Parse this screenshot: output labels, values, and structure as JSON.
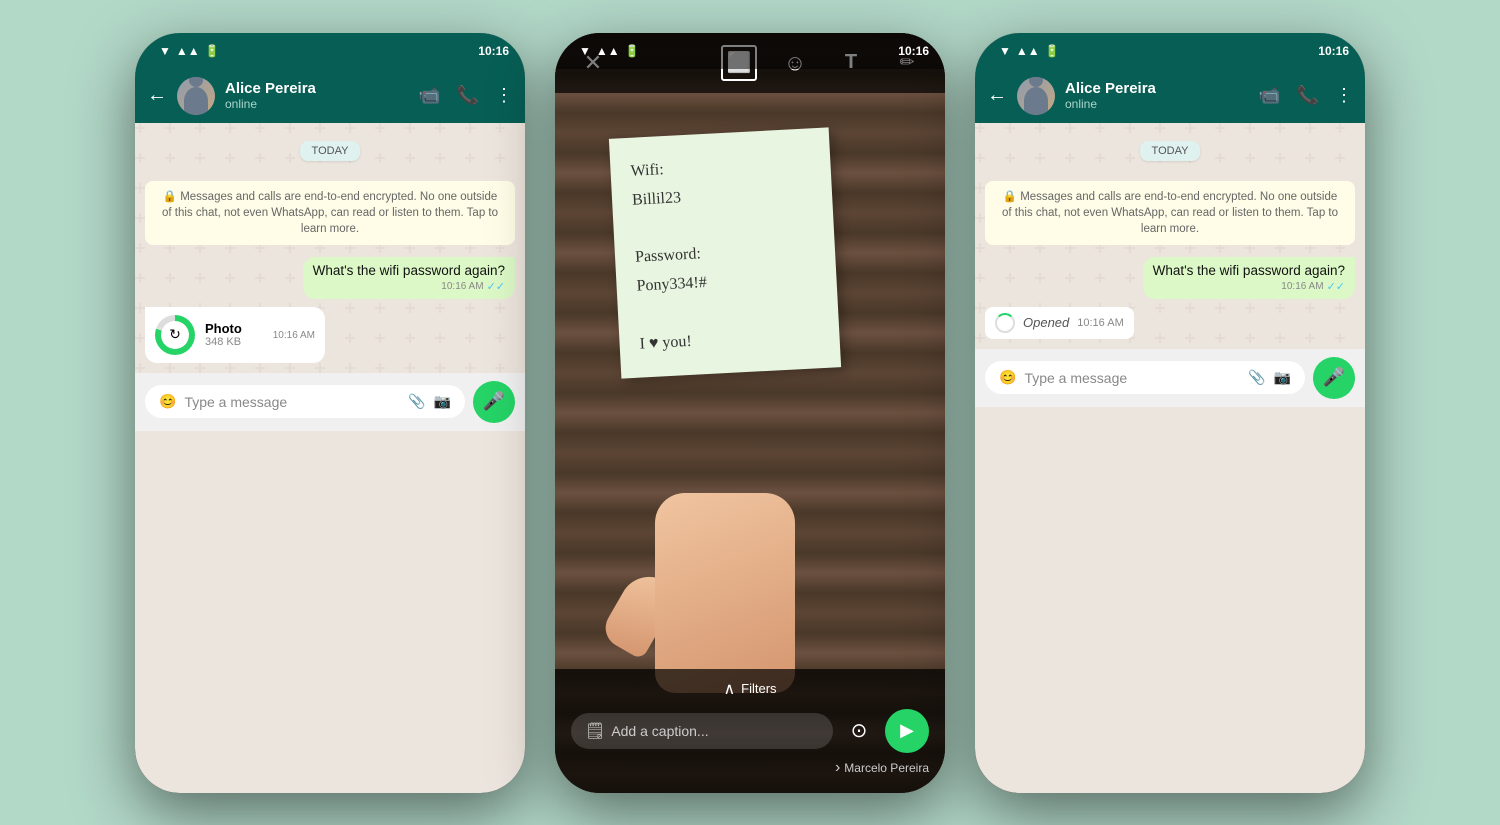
{
  "background": "#b2d8c8",
  "phone1": {
    "status_time": "10:16",
    "header": {
      "contact_name": "Alice Pereira",
      "contact_status": "online",
      "back_label": "←",
      "video_icon": "📹",
      "call_icon": "📞",
      "menu_icon": "⋮"
    },
    "chat": {
      "date_label": "TODAY",
      "encryption_text": "🔒 Messages and calls are end-to-end encrypted. No one outside of this chat, not even WhatsApp, can read or listen to them. Tap to learn more.",
      "sent_message": "What's the wifi password again?",
      "sent_time": "10:16 AM",
      "photo_name": "Photo",
      "photo_size": "348 KB",
      "photo_time": "10:16 AM"
    },
    "input": {
      "placeholder": "Type a message",
      "emoji_icon": "😊",
      "attach_icon": "📎",
      "camera_icon": "📷",
      "mic_icon": "🎤"
    }
  },
  "phone2": {
    "status_time": "10:16",
    "editor": {
      "close_icon": "✕",
      "crop_icon": "⬜",
      "emoji_icon": "☺",
      "text_icon": "T",
      "draw_icon": "✏",
      "sticky_note_text": "Wifi:\nBillil23\n\nPassword:\nPony334!#\n\nI ♥ you!",
      "filters_label": "Filters",
      "filters_up_icon": "∧",
      "caption_placeholder": "Add a caption...",
      "send_icon": "▶",
      "recipient_label": "Marcelo Pereira",
      "recipient_chevron": "›",
      "view_once_icon": "⊙"
    }
  },
  "phone3": {
    "status_time": "10:16",
    "header": {
      "contact_name": "Alice Pereira",
      "contact_status": "online",
      "back_label": "←",
      "video_icon": "📹",
      "call_icon": "📞",
      "menu_icon": "⋮"
    },
    "chat": {
      "date_label": "TODAY",
      "encryption_text": "🔒 Messages and calls are end-to-end encrypted. No one outside of this chat, not even WhatsApp, can read or listen to them. Tap to learn more.",
      "sent_message": "What's the wifi password again?",
      "sent_time": "10:16 AM",
      "opened_label": "Opened",
      "opened_time": "10:16 AM"
    },
    "input": {
      "placeholder": "Type a message",
      "emoji_icon": "😊",
      "attach_icon": "📎",
      "camera_icon": "📷",
      "mic_icon": "🎤"
    }
  }
}
